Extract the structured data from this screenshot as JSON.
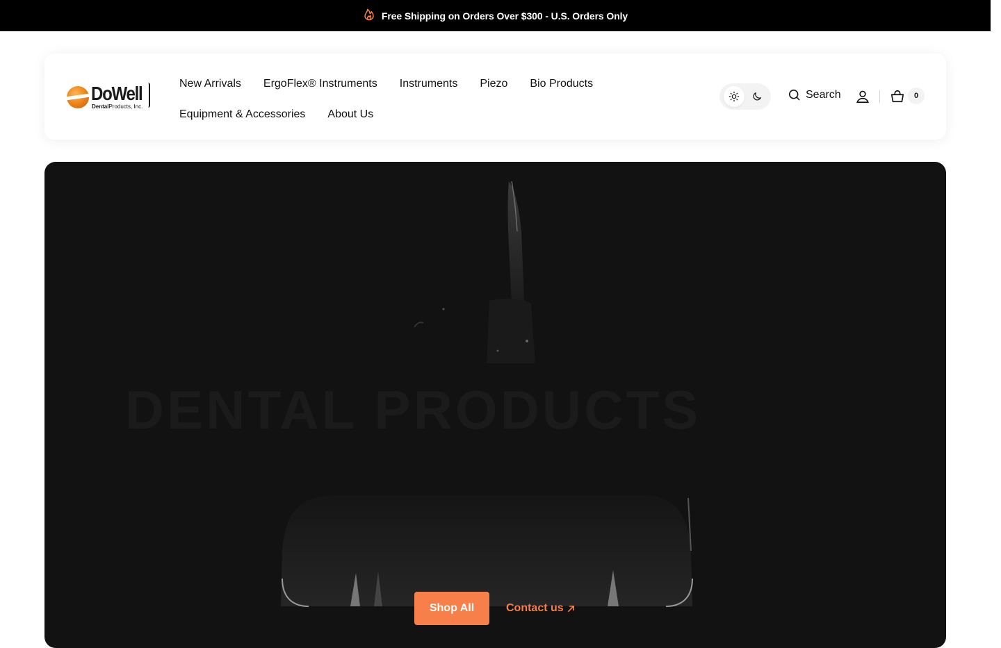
{
  "announcement": {
    "text": "Free Shipping on Orders Over $300 - U.S. Orders Only",
    "icon": "flame-icon",
    "icon_color": "#f7804a"
  },
  "logo": {
    "name": "DoWell",
    "tagline_bold": "Dental",
    "tagline_rest": "Products, Inc."
  },
  "nav": {
    "row1": [
      "New Arrivals",
      "ErgoFlex® Instruments",
      "Instruments",
      "Piezo",
      "Bio Products"
    ],
    "row2": [
      "Equipment & Accessories",
      "About Us"
    ]
  },
  "header_actions": {
    "search_label": "Search",
    "cart_count": "0"
  },
  "hero": {
    "headline": "DENTAL PRODUCTS",
    "primary_cta": "Shop All",
    "secondary_cta": "Contact us",
    "accent": "#f7804a"
  }
}
